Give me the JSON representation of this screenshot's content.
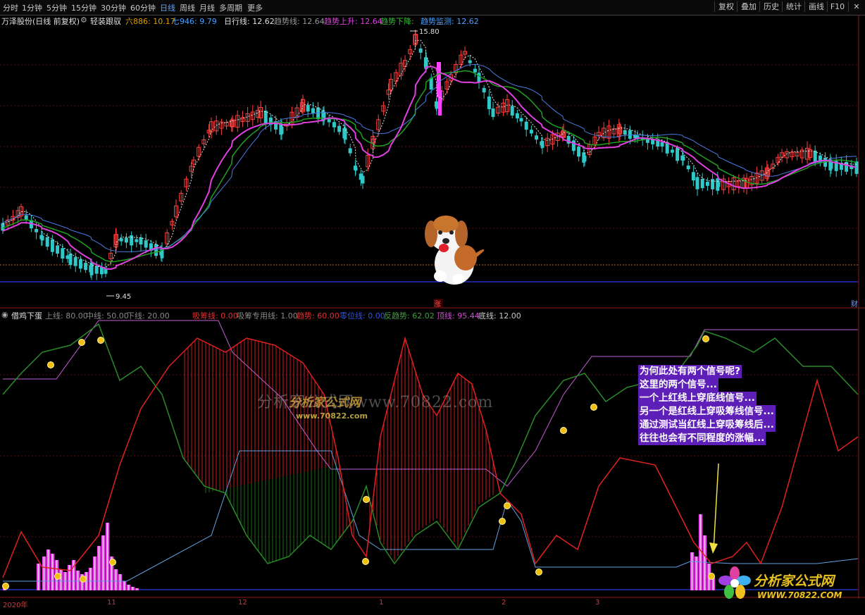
{
  "toolbar": {
    "periods": [
      "分时",
      "1分钟",
      "5分钟",
      "15分钟",
      "30分钟",
      "60分钟",
      "日线",
      "周线",
      "月线",
      "多周期",
      "更多"
    ],
    "active_period": "日线",
    "tools": [
      "复权",
      "叠加",
      "历史",
      "统计",
      "画线",
      "F10"
    ]
  },
  "main_panel": {
    "stock_name": "万泽股份(日线 前复权)",
    "indicator_name": "轻装跟驭",
    "ma_items": [
      {
        "label": "六886: 10.17",
        "color": "#d8a000"
      },
      {
        "label": "七946: 9.79",
        "color": "#4aa0ff"
      },
      {
        "label": "日行线: 12.62",
        "color": "#e0e0e0"
      },
      {
        "label": "趋势线: 12.64",
        "color": "#999999"
      },
      {
        "label": "趋势上升: 12.64",
        "color": "#e040e0"
      },
      {
        "label": "趋势下降:",
        "color": "#30c030"
      },
      {
        "label": "趋势监测: 12.62",
        "color": "#4aa0ff"
      }
    ],
    "high_label": "15.80",
    "low_label": "9.45",
    "rise_tag": "涨",
    "fin_tag": "财"
  },
  "indicator_panel": {
    "name": "借鸡下蛋",
    "items": [
      {
        "label": "上线: 80.00",
        "color": "#888888"
      },
      {
        "label": "中线: 50.00",
        "color": "#888888"
      },
      {
        "label": "下线: 20.00",
        "color": "#888888"
      },
      {
        "label": "吸筹线: 0.00",
        "color": "#e03030"
      },
      {
        "label": "吸筹专用线: 1.00",
        "color": "#888888"
      },
      {
        "label": "趋势: 60.00",
        "color": "#e03030"
      },
      {
        "label": "零位线: 0.00",
        "color": "#3050e0"
      },
      {
        "label": "反趋势: 62.02",
        "color": "#40a040"
      },
      {
        "label": "顶线: 95.44",
        "color": "#d050d0"
      },
      {
        "label": "底线: 12.00",
        "color": "#c8c8c8"
      }
    ]
  },
  "callout": {
    "lines": [
      "为何此处有两个信号呢?",
      "这里的两个信号...",
      "一个上红线上穿底线信号...",
      "另一个是红线上穿吸筹线信号...",
      "通过测试当红线上穿吸筹线后...",
      "往往也会有不同程度的涨幅..."
    ]
  },
  "x_axis": {
    "labels": [
      "2020年",
      "11",
      "12",
      "1",
      "2",
      "3"
    ]
  },
  "watermark": {
    "site_text": "分析家公式网www.70822.com",
    "logo_text": "分析家公式网",
    "logo_url": "www.70822.com"
  },
  "brand": {
    "logo_text": "分析家公式网",
    "url": "WWW.70822.COM"
  },
  "colors": {
    "up": "#ff4040",
    "down": "#30c8c8",
    "background": "#000000",
    "grid": "#6a1010"
  }
}
